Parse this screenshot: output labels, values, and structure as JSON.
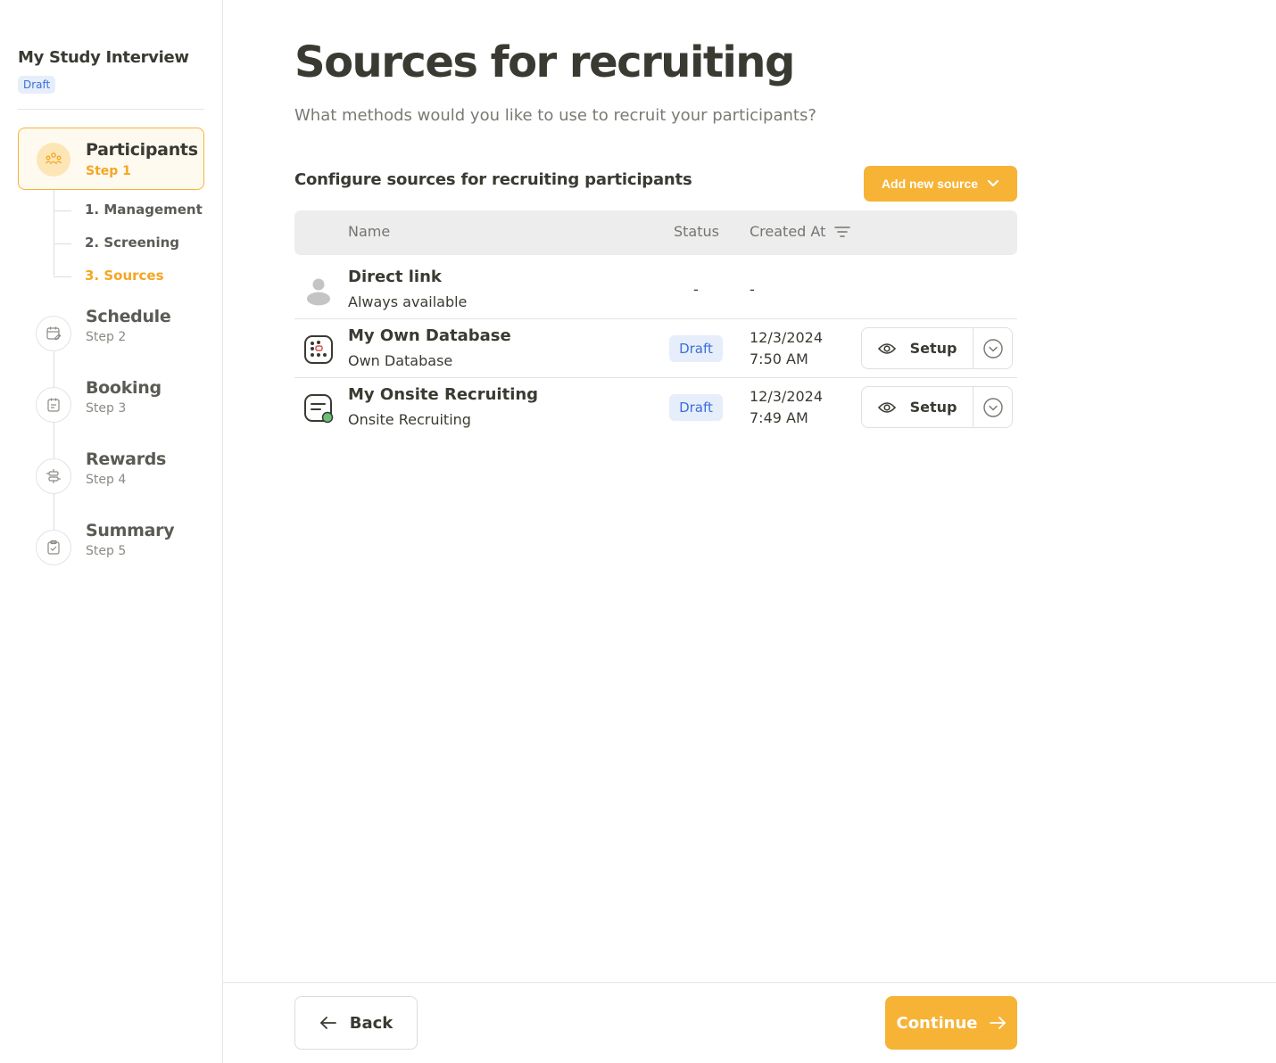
{
  "sidebar": {
    "study_title": "My Study Interview",
    "study_status": "Draft",
    "active_step": {
      "title": "Participants",
      "sub": "Step 1",
      "icon": "participants-icon"
    },
    "substeps": [
      {
        "label": "1. Management"
      },
      {
        "label": "2. Screening"
      },
      {
        "label": "3. Sources",
        "current": true
      }
    ],
    "steps": [
      {
        "title": "Schedule",
        "sub": "Step 2",
        "icon": "calendar-edit-icon"
      },
      {
        "title": "Booking",
        "sub": "Step 3",
        "icon": "booking-icon"
      },
      {
        "title": "Rewards",
        "sub": "Step 4",
        "icon": "rewards-icon"
      },
      {
        "title": "Summary",
        "sub": "Step 5",
        "icon": "clipboard-check-icon"
      }
    ]
  },
  "main": {
    "title": "Sources for recruiting",
    "subtitle": "What methods would you like to use to recruit your participants?",
    "section_title": "Configure sources for recruiting participants",
    "add_source_label": "Add new source",
    "table": {
      "columns": {
        "name": "Name",
        "status": "Status",
        "created": "Created At"
      },
      "rows": [
        {
          "name": "Direct link",
          "type": "Always available",
          "status": "-",
          "created": "-",
          "icon": "person-icon"
        },
        {
          "name": "My Own Database",
          "type": "Own Database",
          "status": "Draft",
          "created_date": "12/3/2024",
          "created_time": "7:50 AM",
          "icon": "database-icon",
          "action": "Setup"
        },
        {
          "name": "My Onsite Recruiting",
          "type": "Onsite Recruiting",
          "status": "Draft",
          "created_date": "12/3/2024",
          "created_time": "7:49 AM",
          "icon": "onsite-form-icon",
          "action": "Setup"
        }
      ]
    }
  },
  "footer": {
    "back_label": "Back",
    "continue_label": "Continue"
  },
  "colors": {
    "accent": "#f6b335",
    "accent_text": "#f5a623",
    "badge_bg": "#e6eefc",
    "badge_text": "#3d6fd6",
    "text": "#3a3a33"
  }
}
